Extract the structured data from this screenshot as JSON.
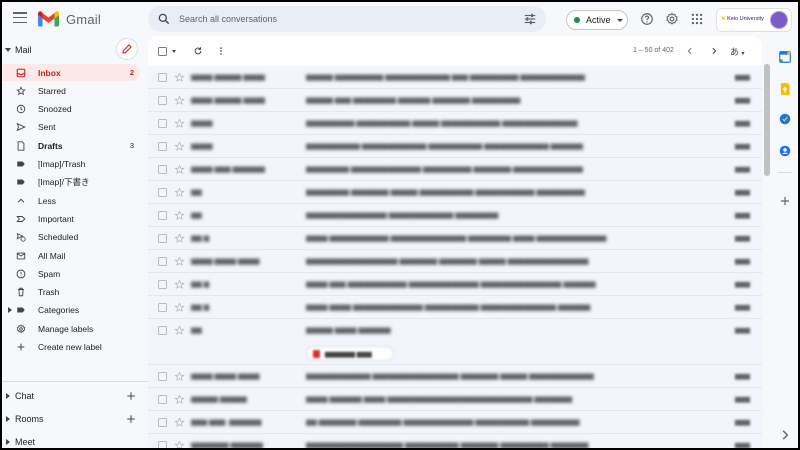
{
  "app": {
    "name": "Gmail"
  },
  "search": {
    "placeholder": "Search all conversations"
  },
  "status": {
    "label": "Active"
  },
  "account": {
    "org": "Keio University"
  },
  "sidebar": {
    "mail_label": "Mail",
    "items": [
      {
        "label": "Inbox",
        "count": "2",
        "icon": "inbox-icon",
        "active": true
      },
      {
        "label": "Starred",
        "count": "",
        "icon": "star-icon"
      },
      {
        "label": "Snoozed",
        "count": "",
        "icon": "clock-icon"
      },
      {
        "label": "Sent",
        "count": "",
        "icon": "send-icon"
      },
      {
        "label": "Drafts",
        "count": "3",
        "icon": "draft-icon",
        "bold": true
      },
      {
        "label": "[Imap]/Trash",
        "count": "",
        "icon": "label-icon"
      },
      {
        "label": "[Imap]/下書き",
        "count": "",
        "icon": "label-icon"
      },
      {
        "label": "Less",
        "count": "",
        "icon": "chevron-up-icon"
      },
      {
        "label": "Important",
        "count": "",
        "icon": "important-icon"
      },
      {
        "label": "Scheduled",
        "count": "",
        "icon": "scheduled-icon"
      },
      {
        "label": "All Mail",
        "count": "",
        "icon": "all-mail-icon"
      },
      {
        "label": "Spam",
        "count": "",
        "icon": "spam-icon"
      },
      {
        "label": "Trash",
        "count": "",
        "icon": "trash-icon"
      },
      {
        "label": "Categories",
        "count": "",
        "icon": "label-icon"
      },
      {
        "label": "Manage labels",
        "count": "",
        "icon": "gear-icon"
      },
      {
        "label": "Create new label",
        "count": "",
        "icon": "plus-icon"
      }
    ],
    "sections": [
      {
        "label": "Chat"
      },
      {
        "label": "Rooms"
      },
      {
        "label": "Meet"
      }
    ]
  },
  "toolbar": {
    "pager": "1 – 50 of 402",
    "input_tools": "あ"
  },
  "colors": {
    "accent": "#c5221f",
    "active_bg": "#fce8e6",
    "status_green": "#1e8e3e"
  }
}
